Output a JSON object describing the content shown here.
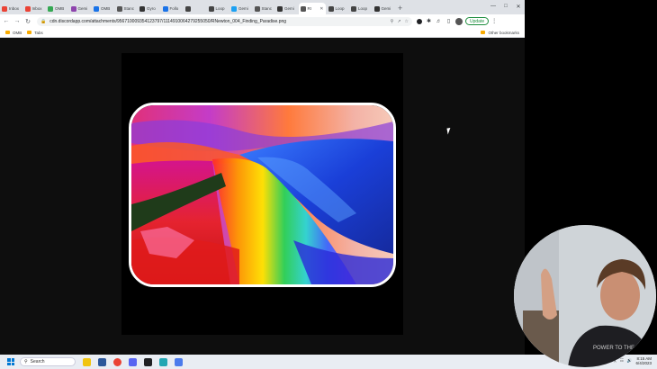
{
  "tabs": [
    {
      "label": "Inbox",
      "color": "#ea4335"
    },
    {
      "label": "Inbox",
      "color": "#ea4335"
    },
    {
      "label": "OMB",
      "color": "#34a853"
    },
    {
      "label": "Gemi",
      "color": "#8e44ad"
    },
    {
      "label": "OMB",
      "color": "#1a73e8"
    },
    {
      "label": "Stanc",
      "color": "#555555"
    },
    {
      "label": "Gyro",
      "color": "#333333"
    },
    {
      "label": "Follo",
      "color": "#1a73e8"
    },
    {
      "label": "",
      "color": "#444444"
    },
    {
      "label": "Loop",
      "color": "#444444"
    },
    {
      "label": "Gemi",
      "color": "#1da1f2"
    },
    {
      "label": "Stanc",
      "color": "#555555"
    },
    {
      "label": "Gemi",
      "color": "#333333"
    }
  ],
  "active_tab": {
    "label": "RI",
    "color": "#555555"
  },
  "tabs_after": [
    {
      "label": "Loop",
      "color": "#444444"
    },
    {
      "label": "Loop",
      "color": "#444444"
    },
    {
      "label": "Gemi",
      "color": "#333333"
    }
  ],
  "toolbar": {
    "url": "cdn.discordapp.com/attachments/956710009354123797/1114910064279255050/RNewton_004_Finding_Paradise.png",
    "update_label": "Update"
  },
  "bookmarks": {
    "items": [
      "OMB",
      "Tabs"
    ],
    "other": "Other bookmarks"
  },
  "taskbar": {
    "search_placeholder": "Search",
    "time": "8:15 AM",
    "date": "6/4/2023",
    "apps": [
      "#f1c40f",
      "#2b579a",
      "#ea4335",
      "#5865f2",
      "#202124",
      "#22a6b3",
      "#4b7bec"
    ]
  }
}
